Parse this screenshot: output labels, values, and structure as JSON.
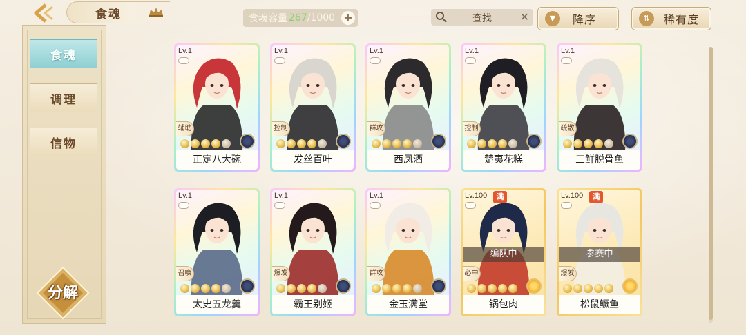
{
  "header": {
    "title": "食魂",
    "capacity_label": "食魂容量",
    "capacity_current": "267",
    "capacity_max": "/1000",
    "plus": "+",
    "search_label": "查找",
    "search_clear": "✕",
    "sort_label": "降序",
    "rarity_label": "稀有度"
  },
  "sidebar": {
    "tabs": [
      {
        "label": "食魂",
        "active": true
      },
      {
        "label": "调理",
        "active": false
      },
      {
        "label": "信物",
        "active": false
      }
    ],
    "decompose_label": "分解"
  },
  "cards": [
    {
      "level": "Lv.1",
      "name": "正定八大碗",
      "role": "辅助",
      "stars": 4,
      "max": false,
      "status": "",
      "emblem": "dark",
      "frame": "rainbow",
      "hair": "#c9363a",
      "robe": "#2a2a2a"
    },
    {
      "level": "Lv.1",
      "name": "发丝百叶",
      "role": "控制",
      "stars": 4,
      "max": false,
      "status": "",
      "emblem": "dark",
      "frame": "rainbow",
      "hair": "#d9d6d0",
      "robe": "#2c2a2e"
    },
    {
      "level": "Lv.1",
      "name": "西凤酒",
      "role": "群攻",
      "stars": 4,
      "max": false,
      "status": "",
      "emblem": "dark",
      "frame": "rainbow",
      "hair": "#2c2a2c",
      "robe": "#8a8a8a"
    },
    {
      "level": "Lv.1",
      "name": "楚夷花糕",
      "role": "控制",
      "stars": 4,
      "max": false,
      "status": "",
      "emblem": "dark",
      "frame": "rainbow",
      "hair": "#1f1e24",
      "robe": "#3e3d44"
    },
    {
      "level": "Lv.1",
      "name": "三鲜脱骨鱼",
      "role": "疏散",
      "stars": 4,
      "max": false,
      "status": "",
      "emblem": "dark",
      "frame": "rainbow",
      "hair": "#e6e2dc",
      "robe": "#2a2022"
    },
    {
      "level": "Lv.1",
      "name": "太史五龙羹",
      "role": "召唤",
      "stars": 4,
      "max": false,
      "status": "",
      "emblem": "dark",
      "frame": "rainbow",
      "hair": "#1d1d24",
      "robe": "#5a6a8a"
    },
    {
      "level": "Lv.1",
      "name": "霸王别姬",
      "role": "爆发",
      "stars": 4,
      "max": false,
      "status": "",
      "emblem": "dark",
      "frame": "rainbow",
      "hair": "#241a1c",
      "robe": "#9c2b2a"
    },
    {
      "level": "Lv.1",
      "name": "金玉满堂",
      "role": "群攻",
      "stars": 4,
      "max": false,
      "status": "",
      "emblem": "dark",
      "frame": "rainbow",
      "hair": "#f1ede6",
      "robe": "#d88a2a"
    },
    {
      "level": "Lv.100",
      "name": "锅包肉",
      "role": "必中",
      "stars": 5,
      "max": true,
      "status": "编队中",
      "emblem": "flower",
      "frame": "gold",
      "hair": "#1f2a4a",
      "robe": "#c23b2a"
    },
    {
      "level": "Lv.100",
      "name": "松鼠鳜鱼",
      "role": "爆发",
      "stars": 5,
      "max": true,
      "status": "参赛中",
      "emblem": "flower",
      "frame": "gold",
      "hair": "#e8e6e0",
      "robe": "#f3eee4"
    }
  ],
  "max_badge": "满",
  "colors": {
    "accent_teal": "#8fd0d3",
    "gold": "#e7b84a",
    "capacity_current": "#8cd26a"
  }
}
